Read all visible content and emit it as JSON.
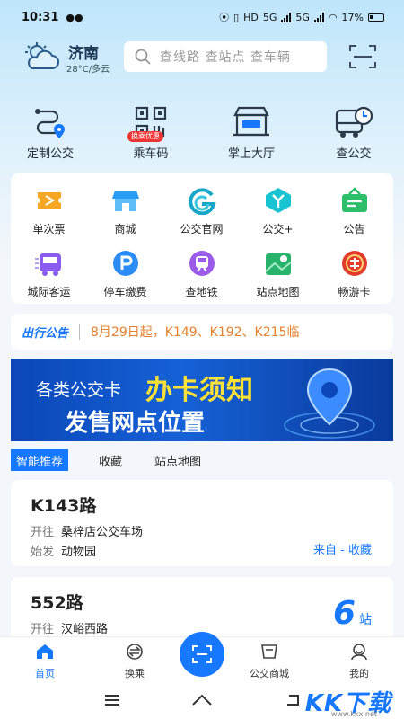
{
  "status_bar": {
    "time": "10:31",
    "battery": "17%",
    "net1": "HD",
    "net2": "5G",
    "net3": "5G"
  },
  "header": {
    "city": "济南",
    "weather": "28°C/多云",
    "search_placeholder": "查线路 查站点 查车辆"
  },
  "top_nav": [
    {
      "label": "定制公交",
      "icon": "custom-bus-icon"
    },
    {
      "label": "乘车码",
      "icon": "qr-code-icon",
      "badge": "换乘优惠"
    },
    {
      "label": "掌上大厅",
      "icon": "hall-icon"
    },
    {
      "label": "查公交",
      "icon": "bus-clock-icon"
    }
  ],
  "grid": [
    {
      "label": "单次票",
      "icon": "ticket-icon"
    },
    {
      "label": "商城",
      "icon": "shop-icon"
    },
    {
      "label": "公交官网",
      "icon": "website-icon"
    },
    {
      "label": "公交+",
      "icon": "bus-plus-icon"
    },
    {
      "label": "公告",
      "icon": "announcement-icon"
    },
    {
      "label": "城际客运",
      "icon": "intercity-bus-icon"
    },
    {
      "label": "停车缴费",
      "icon": "parking-icon"
    },
    {
      "label": "查地铁",
      "icon": "metro-icon"
    },
    {
      "label": "站点地图",
      "icon": "map-icon"
    },
    {
      "label": "畅游卡",
      "icon": "travel-card-icon"
    }
  ],
  "notice": {
    "brand": "出行公告",
    "text": "8月29日起，K149、K192、K215临"
  },
  "banner": {
    "line1a": "各类公交卡",
    "line1b": "办卡须知",
    "line2": "发售网点位置"
  },
  "tabs": [
    "智能推荐",
    "收藏",
    "站点地图"
  ],
  "routes": [
    {
      "name": "K143路",
      "to_label": "开往",
      "to": "桑梓店公交车场",
      "from_label": "始发",
      "from": "动物园",
      "source": "来自 - 收藏"
    },
    {
      "name": "552路",
      "to_label": "开往",
      "to": "汉峪西路",
      "stops": "6",
      "stops_unit": "站"
    }
  ],
  "bottom_nav": [
    {
      "label": "首页",
      "icon": "home-icon"
    },
    {
      "label": "换乘",
      "icon": "transfer-icon"
    },
    {
      "label": "",
      "icon": "scan-icon"
    },
    {
      "label": "公交商城",
      "icon": "mall-icon"
    },
    {
      "label": "我的",
      "icon": "profile-icon"
    }
  ],
  "watermark": {
    "text": "KK下载",
    "url": "www.kkx.net"
  },
  "colors": {
    "accent": "#1677ff",
    "notice_text": "#e4812f",
    "banner_yellow": "#ffe234"
  }
}
